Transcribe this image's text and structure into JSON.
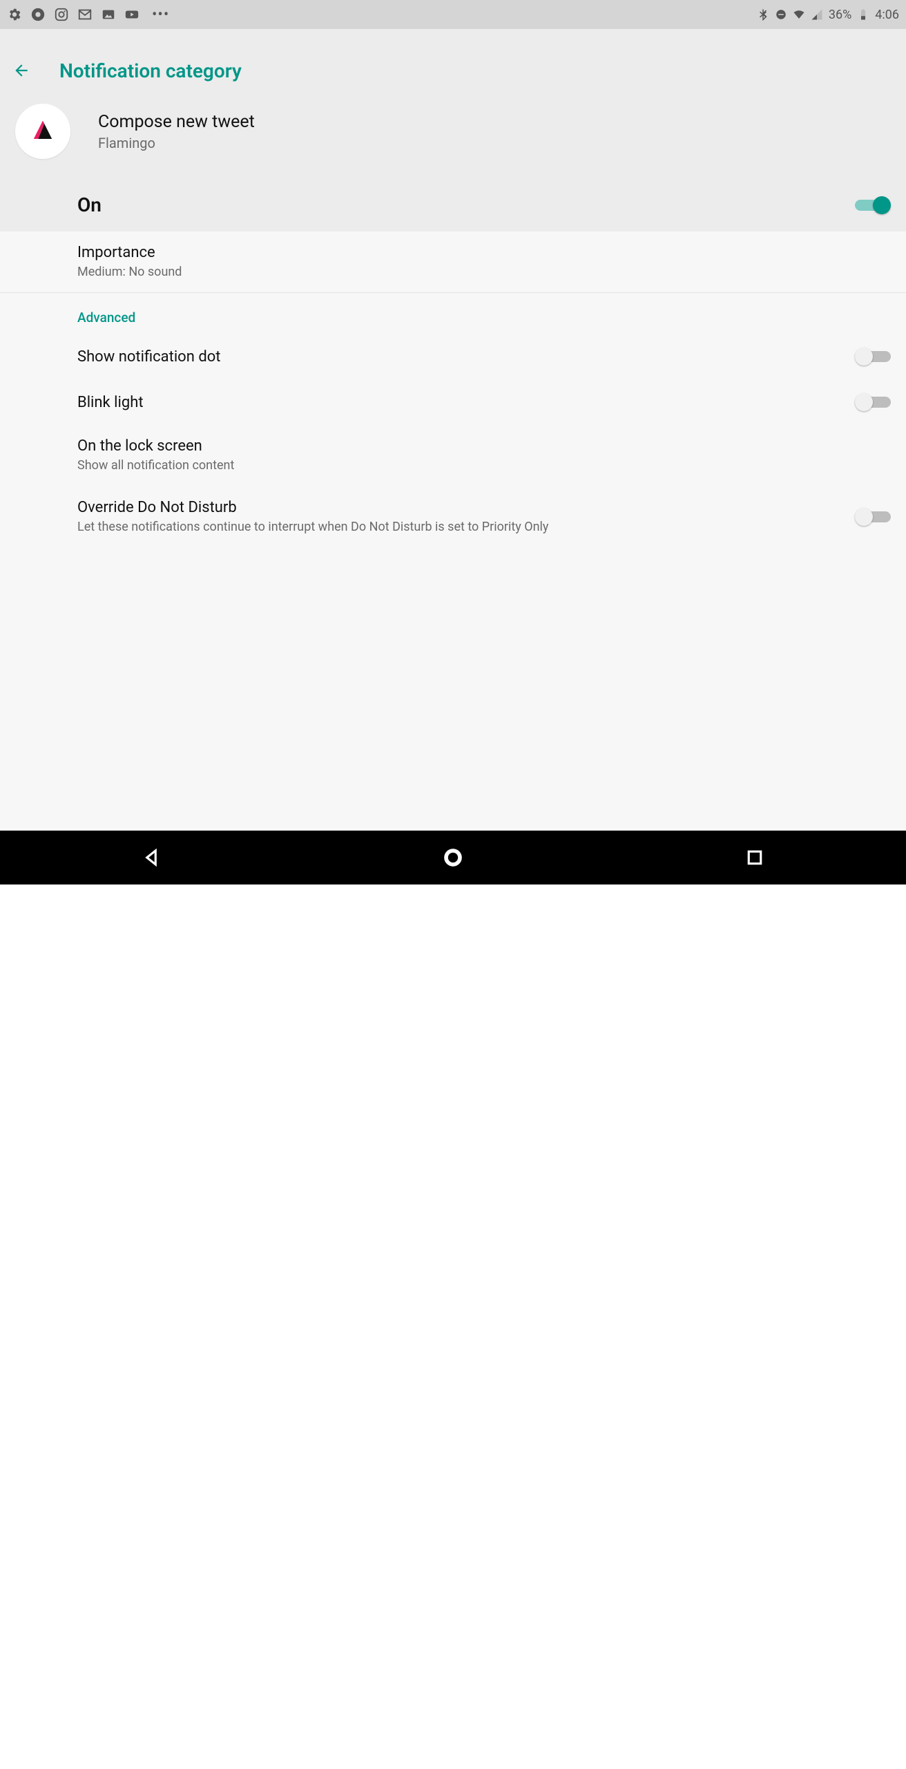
{
  "status": {
    "battery_pct": "36%",
    "time": "4:06"
  },
  "header": {
    "title": "Notification category"
  },
  "app": {
    "title": "Compose new tweet",
    "subtitle": "Flamingo"
  },
  "master_toggle": {
    "label": "On",
    "state": true
  },
  "settings": [
    {
      "title": "Importance",
      "sub": "Medium: No sound",
      "toggle": null,
      "border": true
    }
  ],
  "advanced_header": "Advanced",
  "advanced": [
    {
      "title": "Show notification dot",
      "sub": null,
      "toggle": false
    },
    {
      "title": "Blink light",
      "sub": null,
      "toggle": false
    },
    {
      "title": "On the lock screen",
      "sub": "Show all notification content",
      "toggle": null
    },
    {
      "title": "Override Do Not Disturb",
      "sub": "Let these notifications continue to interrupt when Do Not Disturb is set to Priority Only",
      "toggle": false
    }
  ]
}
